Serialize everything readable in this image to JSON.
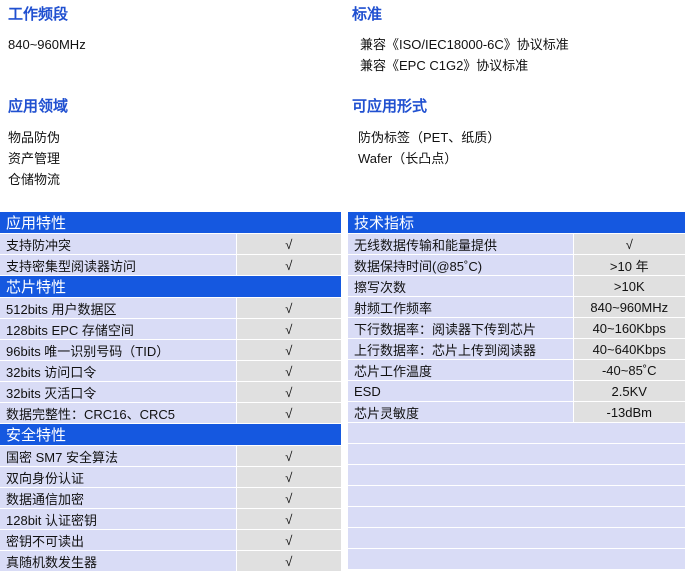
{
  "freq": {
    "title": "工作频段",
    "lines": [
      "840~960MHz"
    ]
  },
  "standard": {
    "title": "标准",
    "lines": [
      "兼容《ISO/IEC18000-6C》协议标准",
      "兼容《EPC C1G2》协议标准"
    ]
  },
  "apps": {
    "title": "应用领域",
    "lines": [
      "物品防伪",
      "资产管理",
      "仓储物流"
    ]
  },
  "forms": {
    "title": "可应用形式",
    "lines": [
      "防伪标签（PET、纸质）",
      "Wafer（长凸点）"
    ]
  },
  "left_table": [
    {
      "header": "应用特性",
      "rows": [
        [
          "支持防冲突",
          "√"
        ],
        [
          "支持密集型阅读器访问",
          "√"
        ]
      ]
    },
    {
      "header": "芯片特性",
      "rows": [
        [
          "512bits 用户数据区",
          "√"
        ],
        [
          "128bits EPC 存储空间",
          "√"
        ],
        [
          "96bits 唯一识别号码（TID）",
          "√"
        ],
        [
          "32bits  访问口令",
          "√"
        ],
        [
          "32bits  灭活口令",
          "√"
        ],
        [
          "数据完整性：CRC16、CRC5",
          "√"
        ]
      ]
    },
    {
      "header": "安全特性",
      "rows": [
        [
          "国密 SM7 安全算法",
          "√"
        ],
        [
          "双向身份认证",
          "√"
        ],
        [
          "数据通信加密",
          "√"
        ],
        [
          "128bit 认证密钥",
          "√"
        ],
        [
          "密钥不可读出",
          "√"
        ],
        [
          "真随机数发生器",
          "√"
        ]
      ]
    }
  ],
  "right_table": {
    "header": "技术指标",
    "rows": [
      [
        "无线数据传输和能量提供",
        "√"
      ],
      [
        "数据保持时间(@85˚C)",
        ">10 年"
      ],
      [
        "擦写次数",
        ">10K"
      ],
      [
        "射频工作频率",
        "840~960MHz"
      ],
      [
        "下行数据率：阅读器下传到芯片",
        "40~160Kbps"
      ],
      [
        "上行数据率：芯片上传到阅读器",
        "40~640Kbps"
      ],
      [
        "芯片工作温度",
        "-40~85˚C"
      ],
      [
        "ESD",
        "2.5KV"
      ],
      [
        "芯片灵敏度",
        "-13dBm"
      ]
    ]
  }
}
